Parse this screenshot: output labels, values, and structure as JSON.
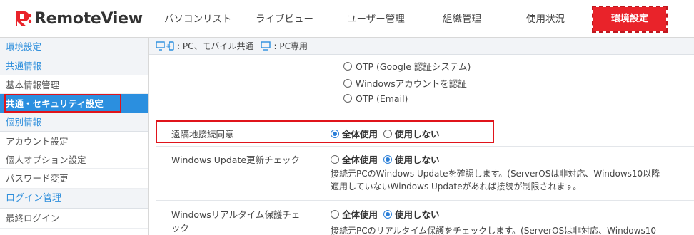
{
  "app": {
    "logo_text": "RemoteView",
    "logo_mark": "R:"
  },
  "nav": {
    "items": [
      {
        "label": "パソコンリスト"
      },
      {
        "label": "ライブビュー"
      },
      {
        "label": "ユーザー管理"
      },
      {
        "label": "組織管理"
      },
      {
        "label": "使用状況"
      },
      {
        "label": "環境設定",
        "active": true
      }
    ]
  },
  "sidebar": {
    "title": "環境設定",
    "section_common": "共通情報",
    "item_basic": "基本情報管理",
    "item_security": "共通・セキュリティ設定",
    "section_individual": "個別情報",
    "item_account": "アカウント設定",
    "item_personal_option": "個人オプション設定",
    "item_password": "パスワード変更",
    "section_login": "ログイン管理",
    "item_last_login": "最終ログイン"
  },
  "legend": {
    "pc_mobile_label": ": PC、モバイル共通",
    "pc_only_label": ": PC専用"
  },
  "auth_options": [
    {
      "label": "OTP (Google 認証システム)",
      "selected": false
    },
    {
      "label": "Windowsアカウントを認証",
      "selected": false
    },
    {
      "label": "OTP (Email)",
      "selected": false
    }
  ],
  "settings": {
    "remote_consent": {
      "label": "遠隔地接続同意",
      "opt_use": "全体使用",
      "opt_no": "使用しない",
      "selected": "use"
    },
    "windows_update": {
      "label": "Windows Update更新チェック",
      "opt_use": "全体使用",
      "opt_no": "使用しない",
      "selected": "no",
      "desc_line1": "接続元PCのWindows Updateを確認します。(ServerOSは非対応、Windows10以降",
      "desc_line2": "適用していないWindows Updateがあれば接続が制限されます。"
    },
    "realtime_protection": {
      "label_line1": "Windowsリアルタイム保護チェ",
      "label_line2": "ック",
      "opt_use": "全体使用",
      "opt_no": "使用しない",
      "selected": "no",
      "desc_line1": "接続元PCのリアルタイム保護をチェックします。(ServerOSは非対応、Windows10"
    }
  },
  "colors": {
    "accent_red": "#e9232a",
    "sidebar_active": "#2b8fdf",
    "link_blue": "#2f8fdc"
  }
}
